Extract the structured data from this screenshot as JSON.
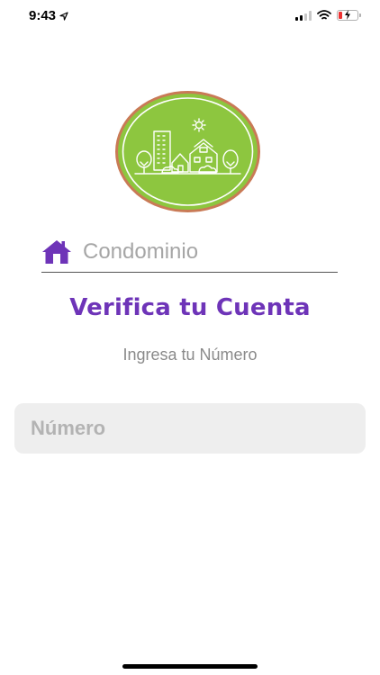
{
  "status_bar": {
    "time": "9:43",
    "icons": [
      "location-arrow-icon",
      "cellular-signal-icon",
      "wifi-icon",
      "battery-charging-icon"
    ]
  },
  "logo": {
    "icon": "condominium-city-logo",
    "colors": {
      "fill": "#8dc63f",
      "border": "#c97a56"
    }
  },
  "condominio": {
    "icon": "home-icon",
    "placeholder": "Condominio"
  },
  "title": "Verifica tu Cuenta",
  "subtitle": "Ingresa tu Número",
  "number_field": {
    "placeholder": "Número"
  },
  "colors": {
    "accent": "#6e34b8",
    "field_bg": "#eeeeee"
  }
}
